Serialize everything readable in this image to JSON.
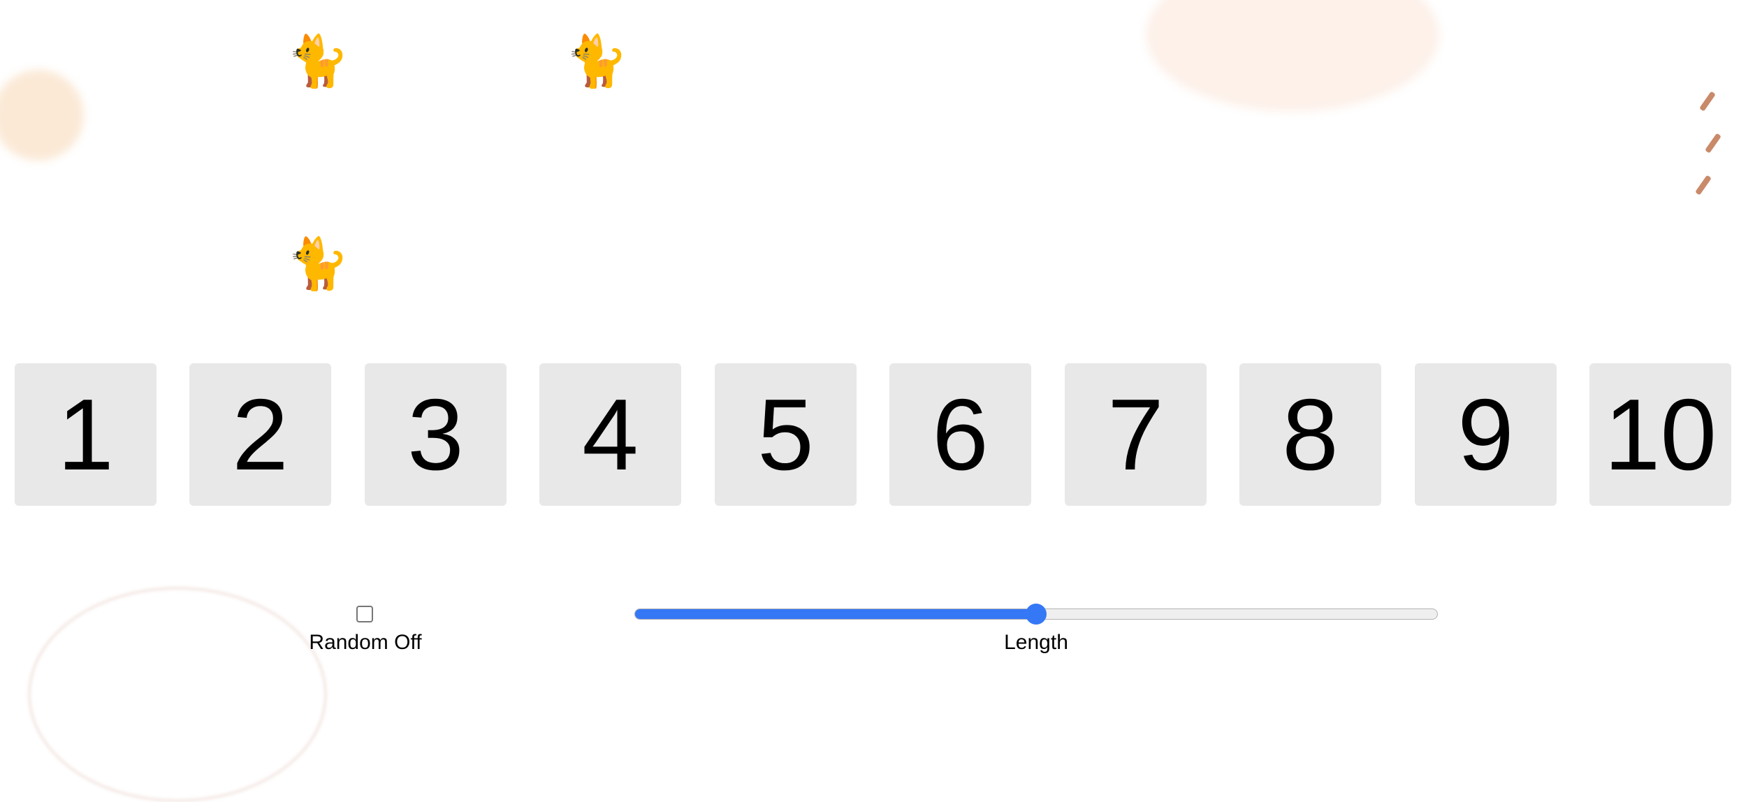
{
  "cats": [
    {
      "icon": "cat-emoji",
      "glyph": "🐈"
    },
    {
      "icon": "cat-emoji",
      "glyph": "🐈"
    },
    {
      "icon": "cat-emoji",
      "glyph": "🐈"
    }
  ],
  "tiles": [
    "1",
    "2",
    "3",
    "4",
    "5",
    "6",
    "7",
    "8",
    "9",
    "10"
  ],
  "controls": {
    "random_label": "Random Off",
    "random_checked": false,
    "length_label": "Length",
    "length_fraction": 0.5
  },
  "colors": {
    "accent": "#3478f6",
    "tile_bg": "#e8e8e8"
  }
}
